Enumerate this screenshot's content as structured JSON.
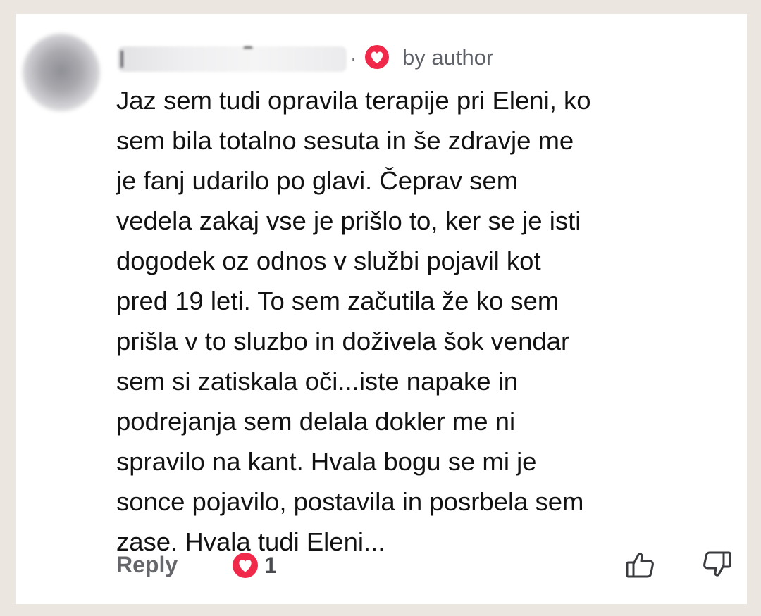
{
  "comment": {
    "author_badge": "by author",
    "separator": "·",
    "text": "Jaz sem tudi opravila terapije pri Eleni, ko\nsem bila totalno sesuta in še zdravje me\nje fanj udarilo po glavi. Čeprav sem\nvedela zakaj vse je prišlo to, ker se je isti\ndogodek oz odnos v službi pojavil kot\npred 19 leti. To sem začutila že ko sem\nprišla v to sluzbo in doživela šok vendar\nsem si zatiskala oči...iste napake in\npodrejanja sem delala dokler me ni\nspravilo na kant. Hvala bogu se mi je\nsonce pojavilo, postavila in posrbela sem\nzase. Hvala tudi Eleni...",
    "reply_label": "Reply",
    "reaction_count": "1",
    "reaction_icon": "heart-icon",
    "like_icon": "thumbs-up-icon",
    "dislike_icon": "thumbs-down-icon"
  },
  "colors": {
    "page_background": "#ebe6df",
    "card_background": "#ffffff",
    "heart_red": "#f02849",
    "text_primary": "#121212",
    "text_secondary": "#65676b"
  }
}
